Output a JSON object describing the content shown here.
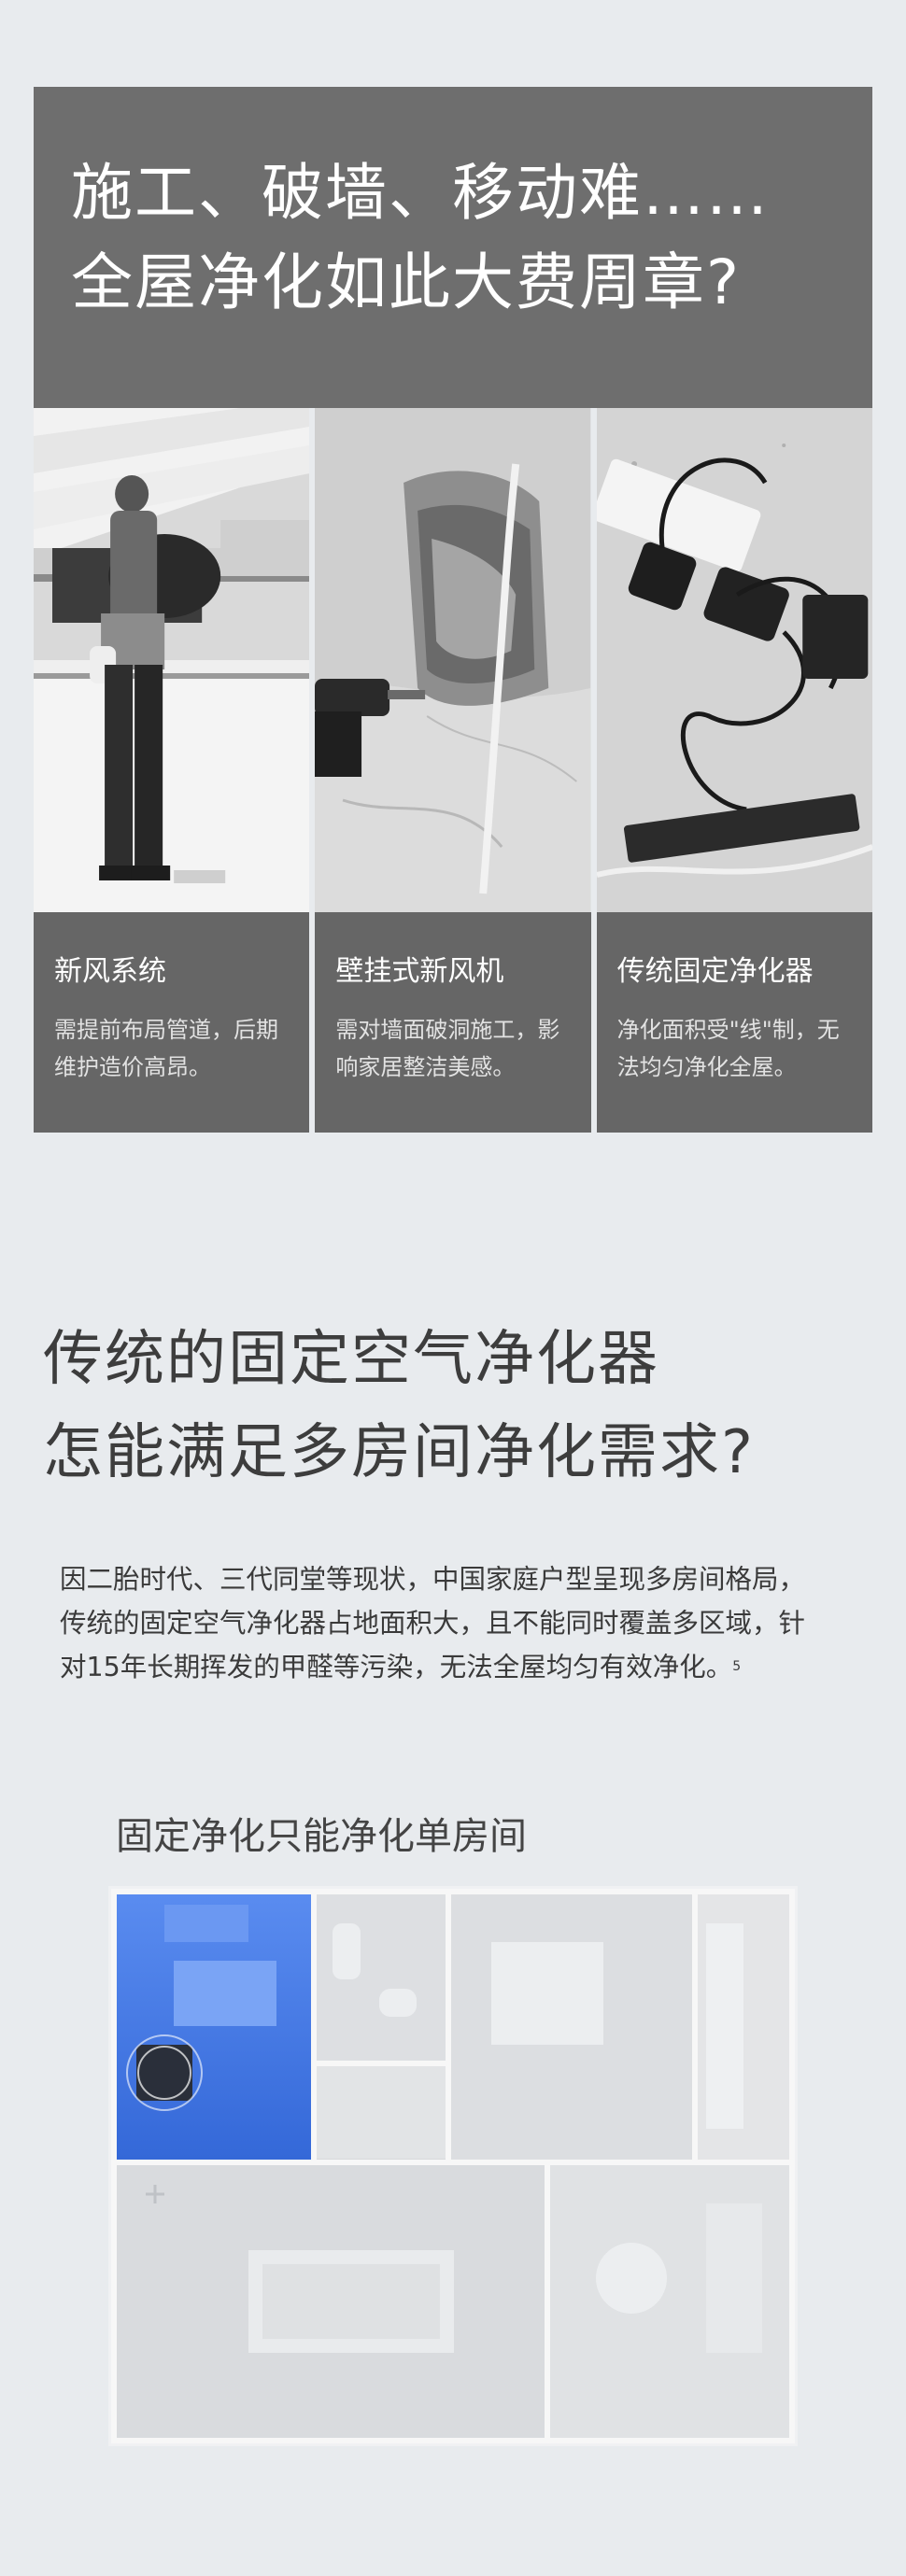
{
  "banner": {
    "title_line1": "施工、破墙、移动难……",
    "title_line2": "全屋净化如此大费周章?"
  },
  "cards": [
    {
      "title": "新风系统",
      "desc": "需提前布局管道，后期维护造价高昂。"
    },
    {
      "title": "壁挂式新风机",
      "desc": "需对墙面破洞施工，影响家居整洁美感。"
    },
    {
      "title": "传统固定净化器",
      "desc": "净化面积受\"线\"制，无法均匀净化全屋。"
    }
  ],
  "section2": {
    "headline_line1": "传统的固定空气净化器",
    "headline_line2": "怎能满足多房间净化需求?",
    "paragraph": "因二胎时代、三代同堂等现状，中国家庭户型呈现多房间格局，传统的固定空气净化器占地面积大，且不能同时覆盖多区域，针对15年长期挥发的甲醛等污染，无法全屋均匀有效净化。",
    "footnote": "5",
    "floorplan_title": "固定净化只能净化单房间"
  },
  "colors": {
    "page_bg": "#e8ebee",
    "banner_bg": "#6e6e6e",
    "card_bg": "#666666",
    "highlight_room": "#3f74e0"
  }
}
